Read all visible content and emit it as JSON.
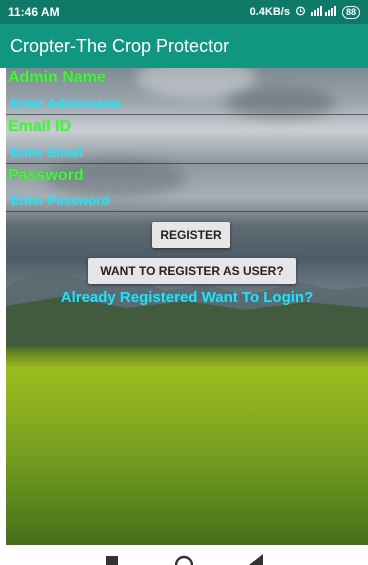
{
  "status_bar": {
    "time": "11:46 AM",
    "net_speed": "0.4KB/s",
    "battery": "88"
  },
  "app_bar": {
    "title": "Cropter-The Crop Protector"
  },
  "form": {
    "admin_name_label": "Admin Name",
    "admin_name_placeholder": "Enter Adminname",
    "email_label": "Email ID",
    "email_placeholder": "Enter Email",
    "password_label": "Password",
    "password_placeholder": "Enter Password"
  },
  "buttons": {
    "register": "REGISTER",
    "register_as_user": "WANT TO REGISTER AS USER?"
  },
  "login_link": "Already Registered Want To Login?",
  "colors": {
    "app_bar": "#119780",
    "status_bar": "#0c7a67",
    "label_green": "#39ff2e",
    "hint_cyan": "#19e7ff"
  },
  "icons": {
    "alarm": "alarm-icon",
    "signal": "signal-icon",
    "battery": "battery-icon",
    "nav_recents": "recents-icon",
    "nav_home": "home-icon",
    "nav_back": "back-icon"
  }
}
